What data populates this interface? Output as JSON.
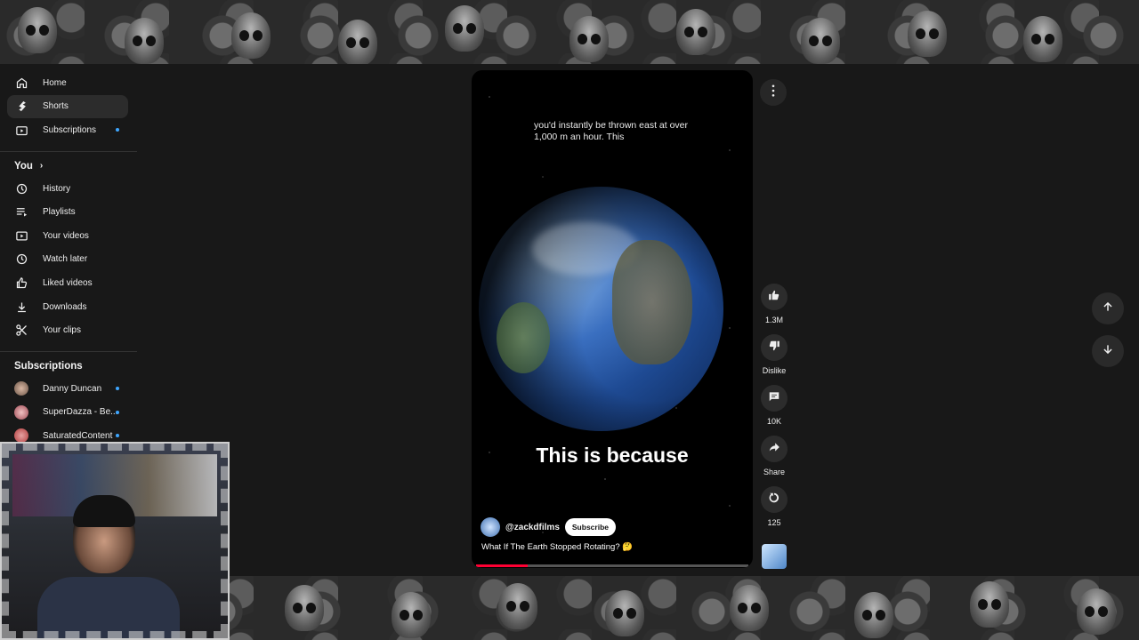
{
  "sidebar": {
    "main": [
      {
        "label": "Home",
        "icon": "home-icon"
      },
      {
        "label": "Shorts",
        "icon": "shorts-icon",
        "active": true
      },
      {
        "label": "Subscriptions",
        "icon": "subscriptions-icon",
        "dot": true
      }
    ],
    "you": {
      "heading": "You",
      "items": [
        {
          "label": "History",
          "icon": "history-icon"
        },
        {
          "label": "Playlists",
          "icon": "playlists-icon"
        },
        {
          "label": "Your videos",
          "icon": "your-videos-icon"
        },
        {
          "label": "Watch later",
          "icon": "watch-later-icon"
        },
        {
          "label": "Liked videos",
          "icon": "liked-videos-icon"
        },
        {
          "label": "Downloads",
          "icon": "downloads-icon"
        },
        {
          "label": "Your clips",
          "icon": "clips-icon"
        }
      ]
    },
    "subscriptions": {
      "heading": "Subscriptions",
      "items": [
        {
          "label": "Danny Duncan",
          "dot": true
        },
        {
          "label": "SuperDazza - Be...",
          "dot": true
        },
        {
          "label": "SaturatedContent",
          "dot": true
        }
      ]
    }
  },
  "short": {
    "caption_top": "you'd instantly be thrown east at over 1,000 m an hour. This",
    "caption_main": "This is because",
    "channel": "@zackdfilms",
    "subscribe_label": "Subscribe",
    "title": "What If The Earth Stopped Rotating? 🤔",
    "progress_fraction": 0.19
  },
  "actions": {
    "like_count": "1.3M",
    "dislike_label": "Dislike",
    "comments_count": "10K",
    "share_label": "Share",
    "remix_count": "125"
  },
  "colors": {
    "accent_red": "#ff0033",
    "subscription_dot": "#3ea6ff"
  }
}
